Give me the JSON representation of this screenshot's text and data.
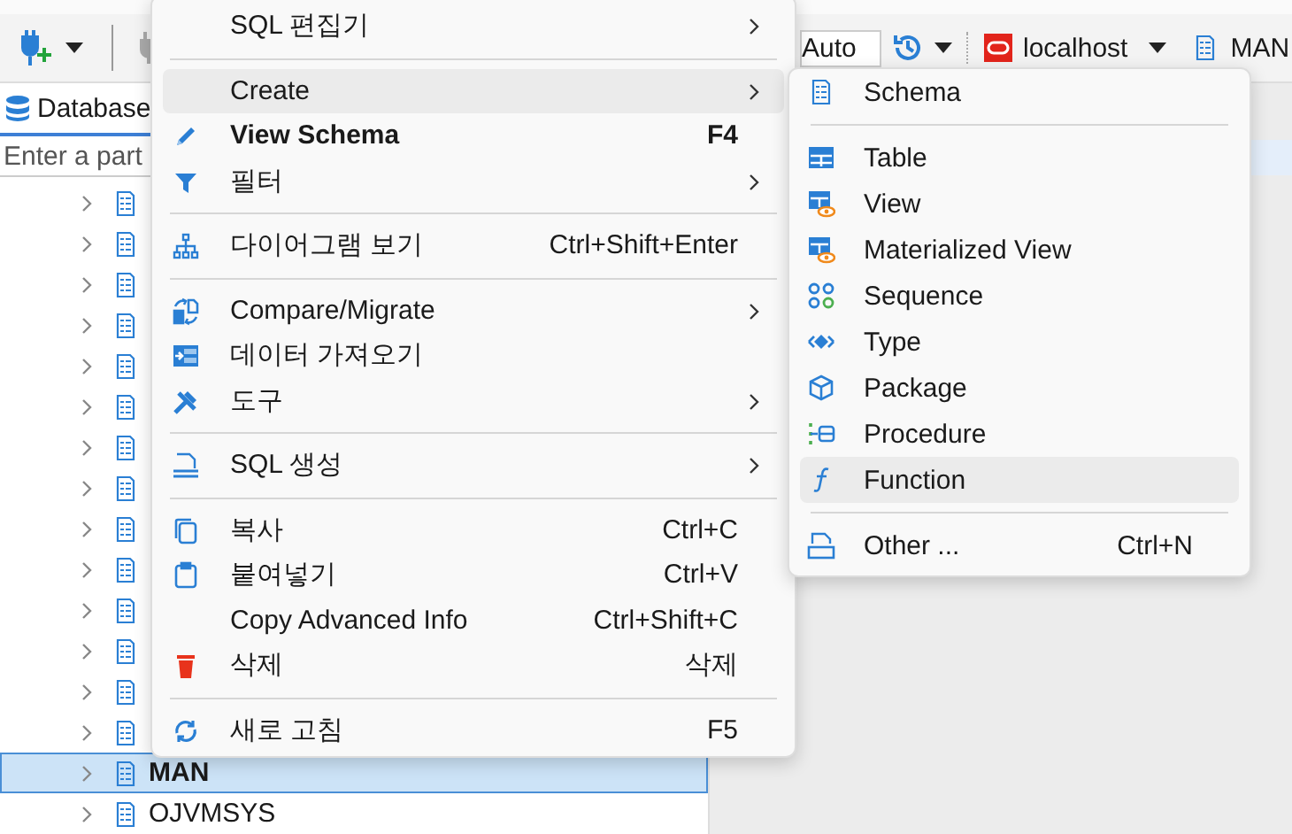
{
  "toolbar": {
    "transaction_mode": "Auto",
    "connection": "localhost",
    "schema": "MAN"
  },
  "panel": {
    "tab": "Database",
    "search_placeholder": "Enter a part"
  },
  "tree": {
    "items": [
      {
        "selected": false
      },
      {
        "selected": false
      },
      {
        "selected": false
      },
      {
        "selected": false
      },
      {
        "selected": false
      },
      {
        "selected": false
      },
      {
        "selected": false
      },
      {
        "selected": false
      },
      {
        "selected": false
      },
      {
        "selected": false
      },
      {
        "selected": false
      },
      {
        "selected": false
      },
      {
        "selected": false
      },
      {
        "selected": false
      },
      {
        "label": "MAN",
        "selected": true
      },
      {
        "label": "OJVMSYS",
        "selected": false
      }
    ]
  },
  "context_menu": {
    "items": [
      {
        "kind": "item",
        "label": "SQL 편집기",
        "submenu": true,
        "selected": false
      },
      {
        "kind": "separator"
      },
      {
        "kind": "item",
        "label": "Create",
        "submenu": true,
        "selected": true
      },
      {
        "kind": "item",
        "label": "View Schema",
        "shortcut": "F4",
        "bold": true,
        "selected": false
      },
      {
        "kind": "item",
        "label": "필터",
        "submenu": true,
        "selected": false
      },
      {
        "kind": "separator"
      },
      {
        "kind": "item",
        "label": "다이어그램 보기",
        "shortcut": "Ctrl+Shift+Enter",
        "selected": false
      },
      {
        "kind": "separator"
      },
      {
        "kind": "item",
        "label": "Compare/Migrate",
        "submenu": true,
        "selected": false
      },
      {
        "kind": "item",
        "label": "데이터 가져오기",
        "selected": false
      },
      {
        "kind": "item",
        "label": "도구",
        "submenu": true,
        "selected": false
      },
      {
        "kind": "separator"
      },
      {
        "kind": "item",
        "label": "SQL 생성",
        "submenu": true,
        "selected": false
      },
      {
        "kind": "separator"
      },
      {
        "kind": "item",
        "label": "복사",
        "shortcut": "Ctrl+C",
        "selected": false
      },
      {
        "kind": "item",
        "label": "붙여넣기",
        "shortcut": "Ctrl+V",
        "selected": false
      },
      {
        "kind": "item",
        "label": "Copy Advanced Info",
        "shortcut": "Ctrl+Shift+C",
        "selected": false
      },
      {
        "kind": "item",
        "label": "삭제",
        "shortcut": "삭제",
        "selected": false
      },
      {
        "kind": "separator"
      },
      {
        "kind": "item",
        "label": "새로 고침",
        "shortcut": "F5",
        "selected": false
      }
    ]
  },
  "create_submenu": {
    "items": [
      {
        "kind": "item",
        "label": "Schema",
        "selected": false
      },
      {
        "kind": "separator"
      },
      {
        "kind": "item",
        "label": "Table",
        "selected": false
      },
      {
        "kind": "item",
        "label": "View",
        "selected": false
      },
      {
        "kind": "item",
        "label": "Materialized View",
        "selected": false
      },
      {
        "kind": "item",
        "label": "Sequence",
        "selected": false
      },
      {
        "kind": "item",
        "label": "Type",
        "selected": false
      },
      {
        "kind": "item",
        "label": "Package",
        "selected": false
      },
      {
        "kind": "item",
        "label": "Procedure",
        "selected": false
      },
      {
        "kind": "item",
        "label": "Function",
        "selected": true
      },
      {
        "kind": "separator"
      },
      {
        "kind": "item",
        "label": "Other ...",
        "shortcut": "Ctrl+N",
        "selected": false
      }
    ]
  }
}
